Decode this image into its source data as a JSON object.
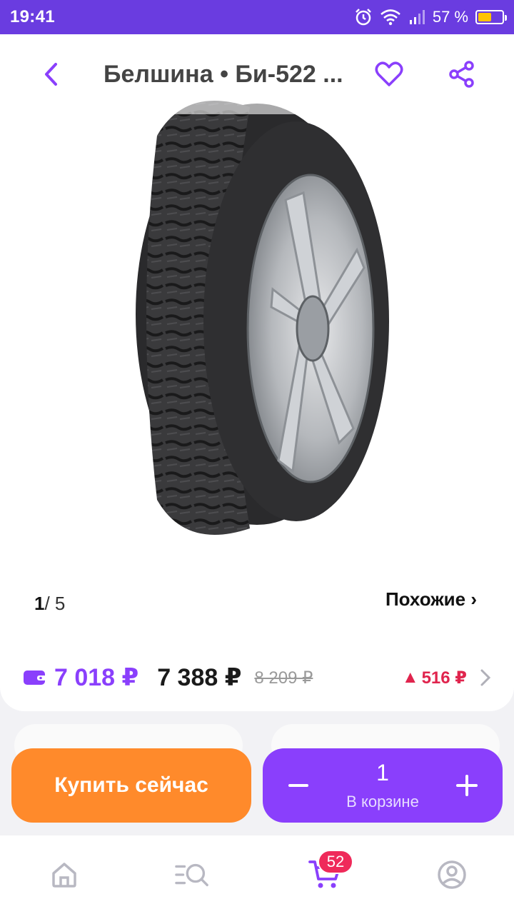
{
  "statusbar": {
    "time": "19:41",
    "battery_pct": "57 %",
    "battery_level": 0.57
  },
  "header": {
    "title": "Белшина • Би-522 ..."
  },
  "gallery": {
    "current": "1",
    "total": "/ 5",
    "similar_label": "Похожие ›"
  },
  "prices": {
    "wallet_price": "7 018 ₽",
    "price": "7 388 ₽",
    "old_price": "8 209 ₽",
    "diff": "516 ₽",
    "diff_arrow": "▲"
  },
  "actions": {
    "buy_label": "Купить сейчас",
    "quantity": "1",
    "in_cart_label": "В корзине",
    "minus": "−",
    "plus": "+"
  },
  "nav": {
    "cart_badge": "52"
  },
  "colors": {
    "accent": "#8a3ffc",
    "buy": "#ff8a2b",
    "statusbar": "#6a3ce0",
    "badge": "#ef2a5a",
    "diff": "#e0244d"
  },
  "icons": [
    "back-icon",
    "heart-icon",
    "share-icon",
    "wallet-icon",
    "home-icon",
    "catalog-search-icon",
    "cart-icon",
    "profile-icon"
  ]
}
